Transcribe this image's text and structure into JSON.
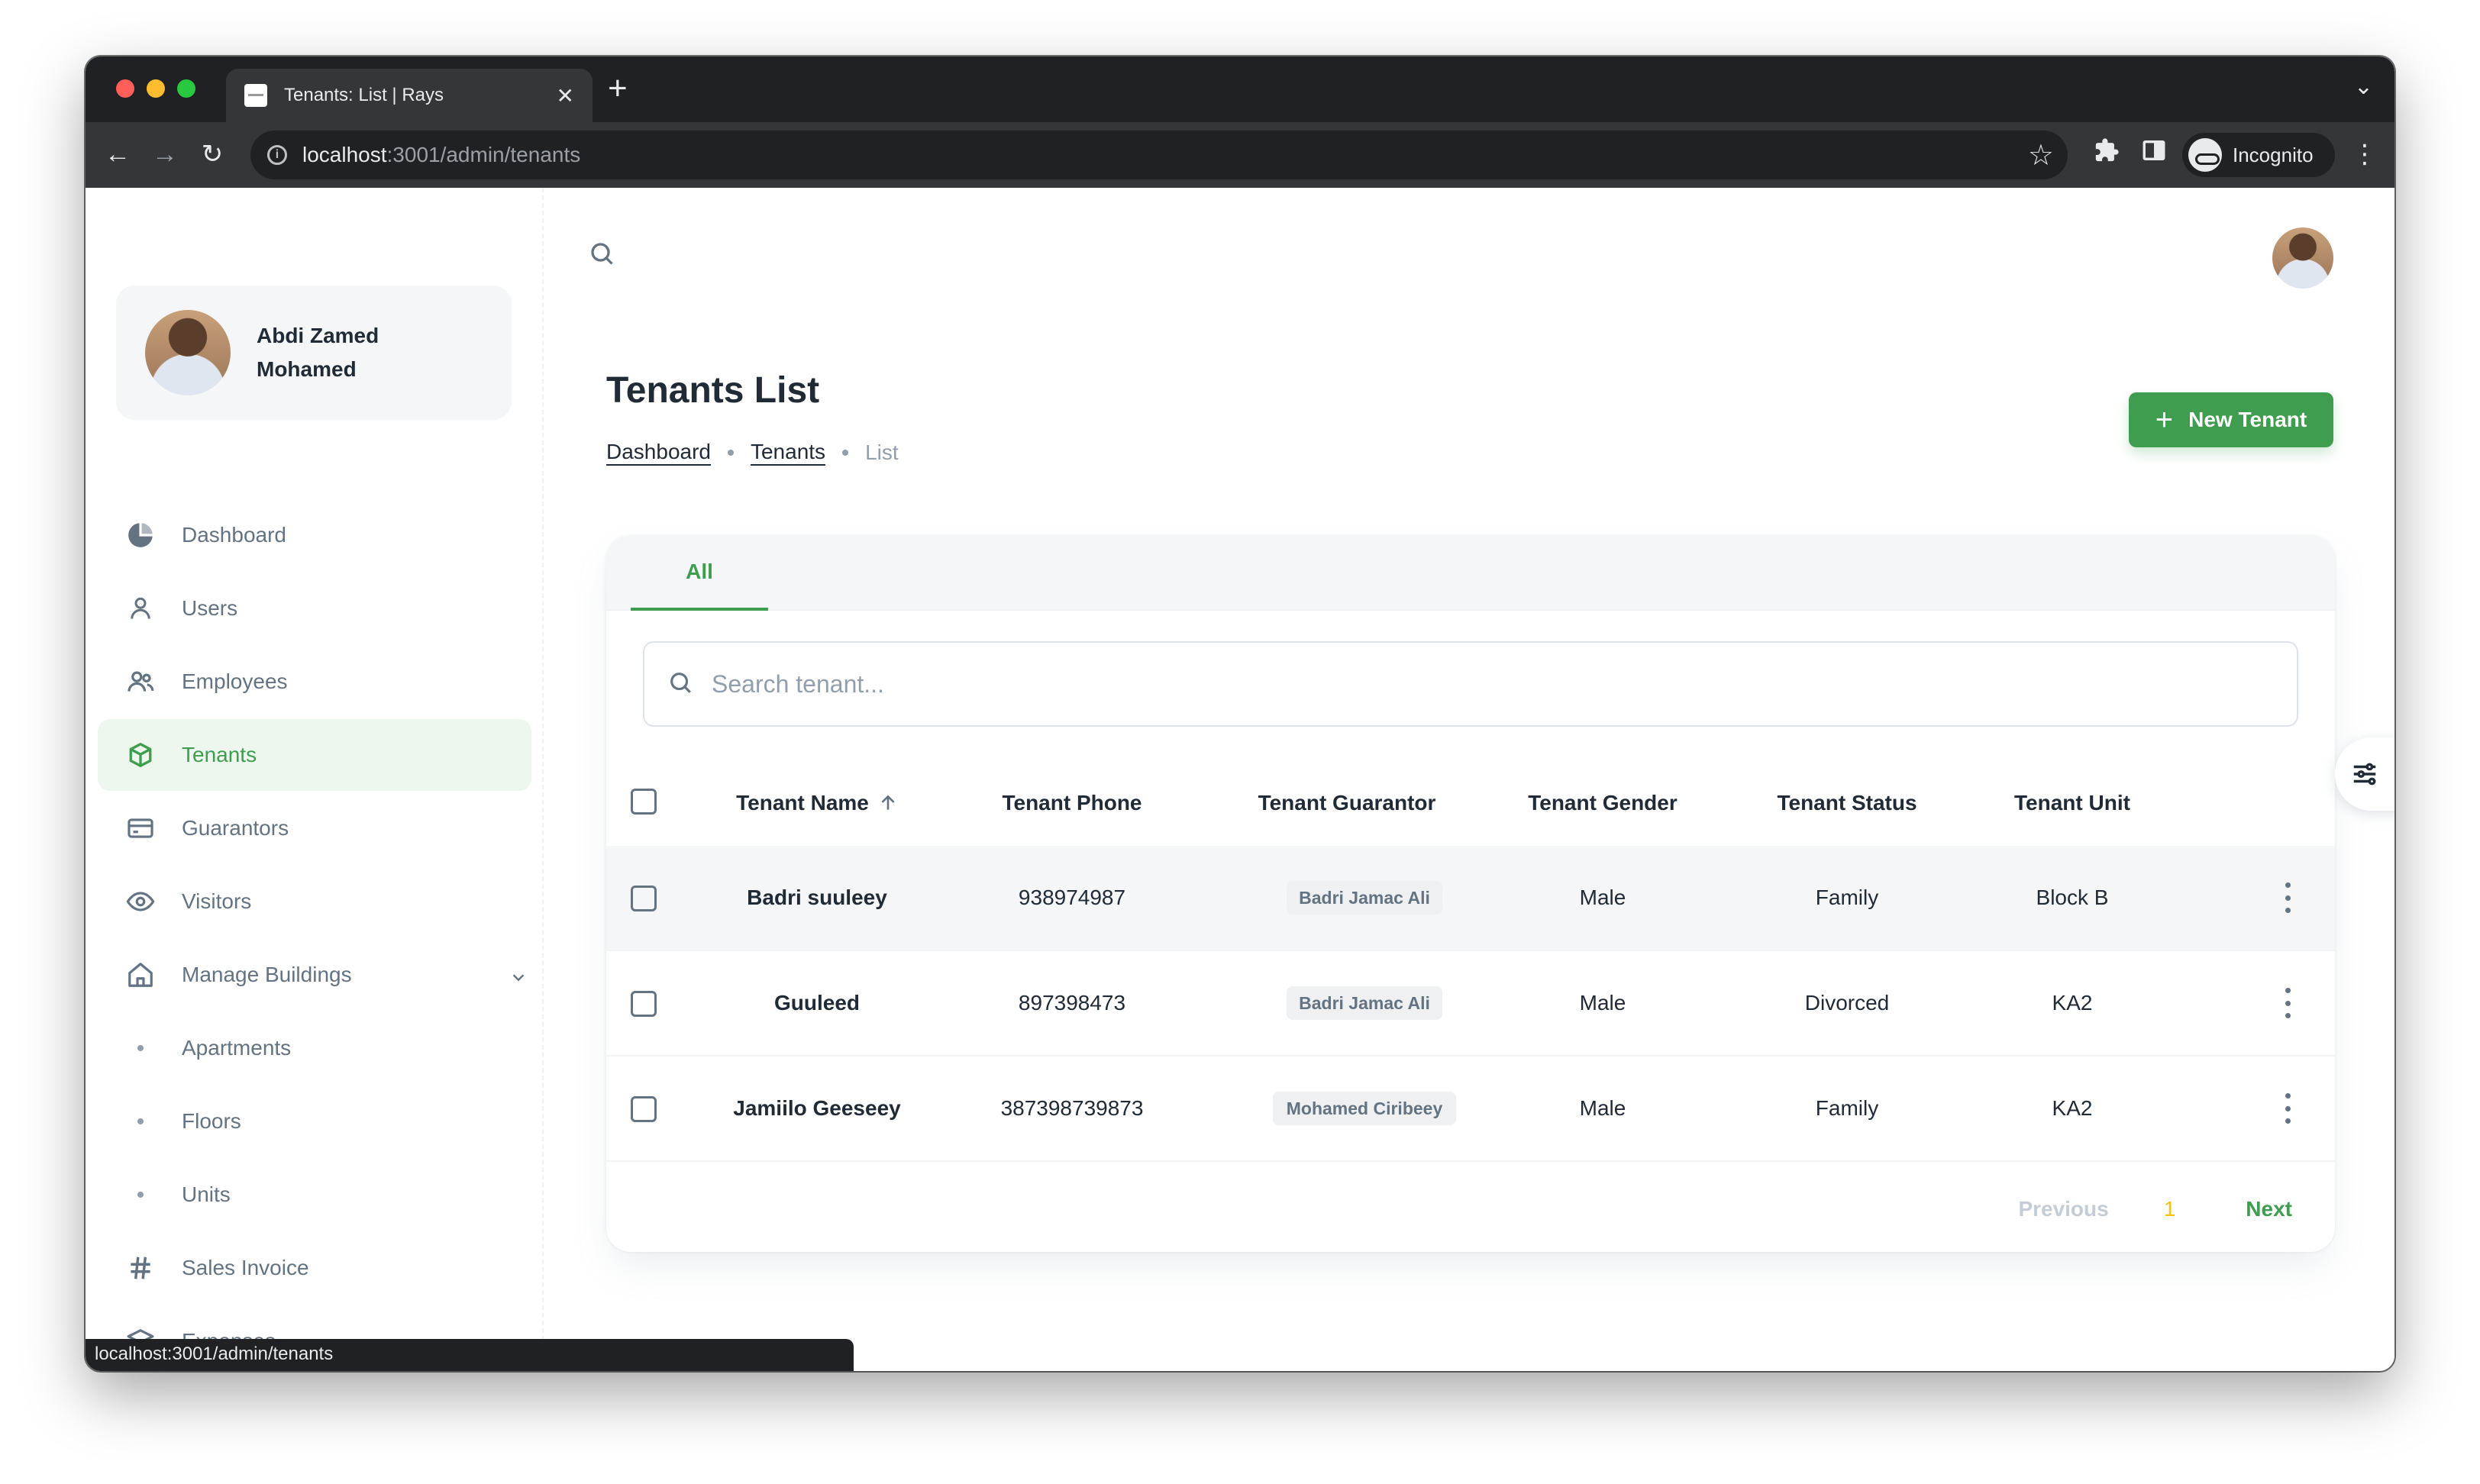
{
  "browser": {
    "tab_title": "Tenants: List | Rays",
    "url_host": "localhost",
    "url_path": ":3001/admin/tenants",
    "profile_label": "Incognito",
    "status_url": "localhost:3001/admin/tenants"
  },
  "account": {
    "name": "Abdi Zamed Mohamed"
  },
  "sidebar": {
    "items": [
      {
        "label": "Dashboard",
        "icon": "pie-chart-icon"
      },
      {
        "label": "Users",
        "icon": "user-icon"
      },
      {
        "label": "Employees",
        "icon": "users-icon"
      },
      {
        "label": "Tenants",
        "icon": "cube-icon",
        "active": true
      },
      {
        "label": "Guarantors",
        "icon": "card-icon"
      },
      {
        "label": "Visitors",
        "icon": "eye-icon"
      },
      {
        "label": "Manage Buildings",
        "icon": "home-icon"
      },
      {
        "label": "Apartments",
        "icon": "dot-icon"
      },
      {
        "label": "Floors",
        "icon": "dot-icon"
      },
      {
        "label": "Units",
        "icon": "dot-icon"
      },
      {
        "label": "Sales Invoice",
        "icon": "hash-icon"
      },
      {
        "label": "Expenses",
        "icon": "layers-icon"
      }
    ]
  },
  "header": {
    "page_title": "Tenants List",
    "breadcrumb": [
      "Dashboard",
      "Tenants",
      "List"
    ],
    "new_button": "New Tenant"
  },
  "table": {
    "tab_all": "All",
    "search_placeholder": "Search tenant...",
    "columns": [
      "Tenant Name",
      "Tenant Phone",
      "Tenant Guarantor",
      "Tenant Gender",
      "Tenant Status",
      "Tenant Unit"
    ],
    "rows": [
      {
        "name": "Badri suuleey",
        "phone": "938974987",
        "guarantor": "Badri Jamac Ali",
        "gender": "Male",
        "status": "Family",
        "unit": "Block B"
      },
      {
        "name": "Guuleed",
        "phone": "897398473",
        "guarantor": "Badri Jamac Ali",
        "gender": "Male",
        "status": "Divorced",
        "unit": "KA2"
      },
      {
        "name": "Jamiilo Geeseey",
        "phone": "387398739873",
        "guarantor": "Mohamed Ciribeey",
        "gender": "Male",
        "status": "Family",
        "unit": "KA2"
      }
    ],
    "pager": {
      "previous": "Previous",
      "page": "1",
      "next": "Next"
    }
  },
  "colors": {
    "accent": "#3f9d4f",
    "page_number": "#ffc107",
    "text_primary": "#212b36",
    "text_secondary": "#637381"
  }
}
